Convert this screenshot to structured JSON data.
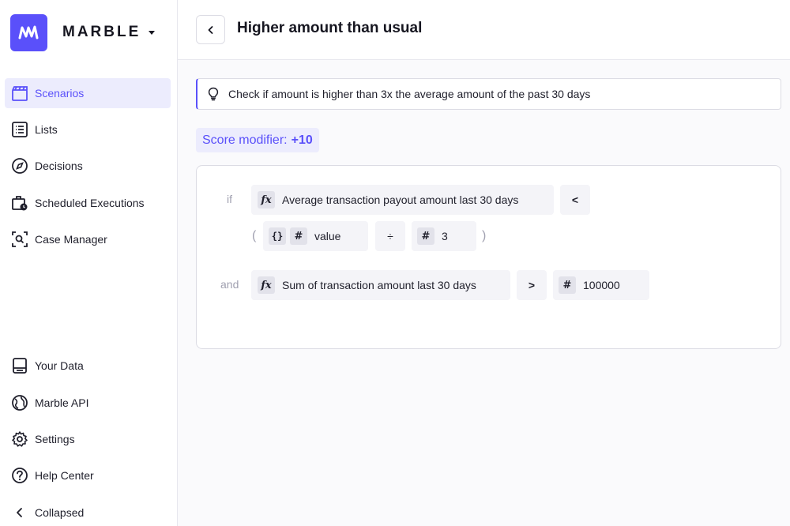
{
  "app": {
    "name": "MARBLE"
  },
  "sidebar": {
    "items": [
      {
        "label": "Scenarios",
        "icon": "clapperboard-icon",
        "active": true
      },
      {
        "label": "Lists",
        "icon": "list-icon"
      },
      {
        "label": "Decisions",
        "icon": "compass-icon"
      },
      {
        "label": "Scheduled Executions",
        "icon": "scheduled-icon"
      },
      {
        "label": "Case Manager",
        "icon": "case-manager-icon"
      }
    ],
    "bottom_items": [
      {
        "label": "Your Data",
        "icon": "data-icon"
      },
      {
        "label": "Marble API",
        "icon": "globe-icon"
      },
      {
        "label": "Settings",
        "icon": "gear-icon"
      },
      {
        "label": "Help Center",
        "icon": "help-icon"
      },
      {
        "label": "Collapsed",
        "icon": "chevron-left-icon"
      }
    ]
  },
  "header": {
    "title": "Higher amount than usual"
  },
  "description": "Check if amount is higher than 3x the average amount of the past 30 days",
  "score": {
    "label": "Score modifier:",
    "value": "+10"
  },
  "rule": {
    "if_keyword": "if",
    "and_keyword": "and",
    "cond1": {
      "left_tag": "fx",
      "left": "Average transaction payout amount last 30 days",
      "operator": "<",
      "open_paren": "(",
      "close_paren": ")",
      "value_tag1": "{}",
      "value_tag2": "#",
      "value": "value",
      "divide": "÷",
      "num_tag": "#",
      "num": "3"
    },
    "cond2": {
      "left_tag": "fx",
      "left": "Sum of transaction amount last 30 days",
      "operator": ">",
      "num_tag": "#",
      "num": "100000"
    }
  },
  "colors": {
    "accent": "#5a50fa",
    "accent_light": "#ececfd"
  }
}
